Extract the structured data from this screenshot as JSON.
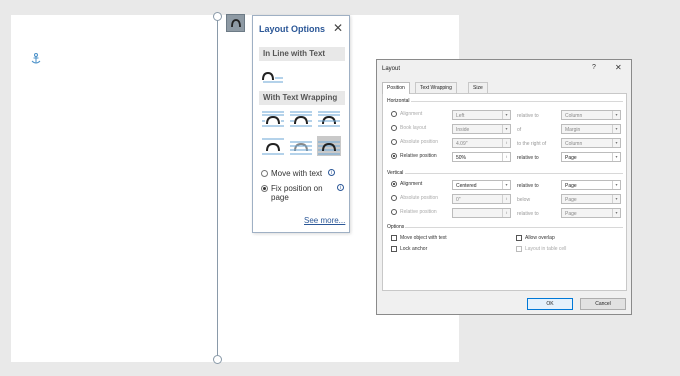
{
  "layout_options": {
    "title": "Layout Options",
    "section_inline": "In Line with Text",
    "section_wrapping": "With Text Wrapping",
    "move_with_text": "Move with text",
    "fix_position": "Fix position on page",
    "see_more": "See more..."
  },
  "dialog": {
    "title": "Layout",
    "help": "?",
    "close": "✕",
    "tabs": [
      "Position",
      "Text Wrapping",
      "Size"
    ],
    "horizontal": {
      "label": "Horizontal",
      "alignment_label": "Alignment",
      "alignment_value": "Left",
      "alignment_rel_label": "relative to",
      "alignment_rel_value": "Column",
      "book_layout_label": "Book layout",
      "book_layout_value": "Inside",
      "book_layout_rel_label": "of",
      "book_layout_rel_value": "Margin",
      "absolute_label": "Absolute position",
      "absolute_value": "4.09\"",
      "absolute_rel_label": "to the right of",
      "absolute_rel_value": "Column",
      "relative_label": "Relative position",
      "relative_value": "50%",
      "relative_rel_label": "relative to",
      "relative_rel_value": "Page"
    },
    "vertical": {
      "label": "Vertical",
      "alignment_label": "Alignment",
      "alignment_value": "Centered",
      "alignment_rel_label": "relative to",
      "alignment_rel_value": "Page",
      "absolute_label": "Absolute position",
      "absolute_value": "0\"",
      "absolute_rel_label": "below",
      "absolute_rel_value": "Page",
      "relative_label": "Relative position",
      "relative_value": "",
      "relative_rel_label": "relative to",
      "relative_rel_value": "Page"
    },
    "options": {
      "label": "Options",
      "move_object": "Move object with text",
      "lock_anchor": "Lock anchor",
      "allow_overlap": "Allow overlap",
      "layout_in_cell": "Layout in table cell"
    },
    "ok": "OK",
    "cancel": "Cancel"
  }
}
